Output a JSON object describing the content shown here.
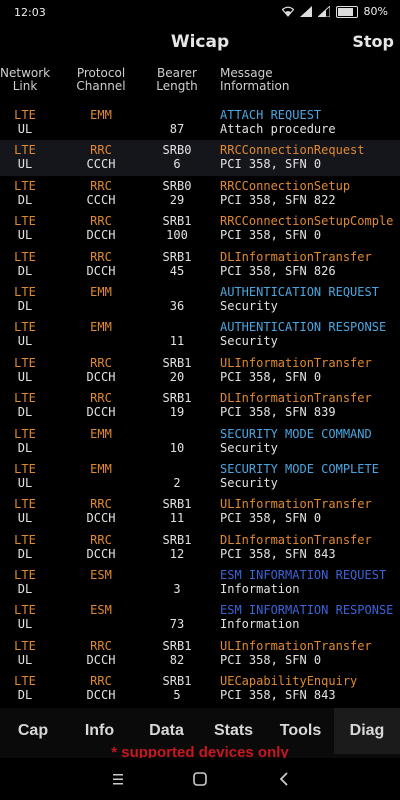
{
  "status_bar": {
    "time": "12:03",
    "battery": "80%",
    "icons": [
      "wifi-icon",
      "signal-icon",
      "signal-icon",
      "battery-icon"
    ]
  },
  "app": {
    "title": "Wicap",
    "stop_label": "Stop"
  },
  "columns": {
    "network": [
      "Network",
      "Link"
    ],
    "protocol": [
      "Protocol",
      "Channel"
    ],
    "bearer": [
      "Bearer",
      "Length"
    ],
    "message": [
      "Message",
      "Information"
    ]
  },
  "colors": {
    "orange": "#e0892f",
    "lightblue": "#4aa6e0",
    "blue": "#3a63d8",
    "notice_red": "#c8171f"
  },
  "rows": [
    {
      "net": "LTE",
      "link": "UL",
      "proto": "EMM",
      "chan": "",
      "bearer": "",
      "len": "87",
      "msg": "ATTACH REQUEST",
      "info": "Attach procedure",
      "color": "lightblue"
    },
    {
      "net": "LTE",
      "link": "UL",
      "proto": "RRC",
      "chan": "CCCH",
      "bearer": "SRB0",
      "len": "6",
      "msg": "RRCConnectionRequest",
      "info": "PCI 358, SFN 0",
      "color": "orange",
      "selected": true
    },
    {
      "net": "LTE",
      "link": "DL",
      "proto": "RRC",
      "chan": "CCCH",
      "bearer": "SRB0",
      "len": "29",
      "msg": "RRCConnectionSetup",
      "info": "PCI 358, SFN 822",
      "color": "orange"
    },
    {
      "net": "LTE",
      "link": "UL",
      "proto": "RRC",
      "chan": "DCCH",
      "bearer": "SRB1",
      "len": "100",
      "msg": "RRCConnectionSetupComple",
      "info": "PCI 358, SFN 0",
      "color": "orange"
    },
    {
      "net": "LTE",
      "link": "DL",
      "proto": "RRC",
      "chan": "DCCH",
      "bearer": "SRB1",
      "len": "45",
      "msg": "DLInformationTransfer",
      "info": "PCI 358, SFN 826",
      "color": "orange"
    },
    {
      "net": "LTE",
      "link": "DL",
      "proto": "EMM",
      "chan": "",
      "bearer": "",
      "len": "36",
      "msg": "AUTHENTICATION REQUEST",
      "info": "Security",
      "color": "lightblue"
    },
    {
      "net": "LTE",
      "link": "UL",
      "proto": "EMM",
      "chan": "",
      "bearer": "",
      "len": "11",
      "msg": "AUTHENTICATION RESPONSE",
      "info": "Security",
      "color": "lightblue"
    },
    {
      "net": "LTE",
      "link": "UL",
      "proto": "RRC",
      "chan": "DCCH",
      "bearer": "SRB1",
      "len": "20",
      "msg": "ULInformationTransfer",
      "info": "PCI 358, SFN 0",
      "color": "orange"
    },
    {
      "net": "LTE",
      "link": "DL",
      "proto": "RRC",
      "chan": "DCCH",
      "bearer": "SRB1",
      "len": "19",
      "msg": "DLInformationTransfer",
      "info": "PCI 358, SFN 839",
      "color": "orange"
    },
    {
      "net": "LTE",
      "link": "DL",
      "proto": "EMM",
      "chan": "",
      "bearer": "",
      "len": "10",
      "msg": "SECURITY MODE COMMAND",
      "info": "Security",
      "color": "lightblue"
    },
    {
      "net": "LTE",
      "link": "UL",
      "proto": "EMM",
      "chan": "",
      "bearer": "",
      "len": "2",
      "msg": "SECURITY MODE COMPLETE",
      "info": "Security",
      "color": "lightblue"
    },
    {
      "net": "LTE",
      "link": "UL",
      "proto": "RRC",
      "chan": "DCCH",
      "bearer": "SRB1",
      "len": "11",
      "msg": "ULInformationTransfer",
      "info": "PCI 358, SFN 0",
      "color": "orange"
    },
    {
      "net": "LTE",
      "link": "DL",
      "proto": "RRC",
      "chan": "DCCH",
      "bearer": "SRB1",
      "len": "12",
      "msg": "DLInformationTransfer",
      "info": "PCI 358, SFN 843",
      "color": "orange"
    },
    {
      "net": "LTE",
      "link": "DL",
      "proto": "ESM",
      "chan": "",
      "bearer": "",
      "len": "3",
      "msg": "ESM INFORMATION REQUEST",
      "info": "Information",
      "color": "blue"
    },
    {
      "net": "LTE",
      "link": "UL",
      "proto": "ESM",
      "chan": "",
      "bearer": "",
      "len": "73",
      "msg": "ESM INFORMATION RESPONSE",
      "info": "Information",
      "color": "blue"
    },
    {
      "net": "LTE",
      "link": "UL",
      "proto": "RRC",
      "chan": "DCCH",
      "bearer": "SRB1",
      "len": "82",
      "msg": "ULInformationTransfer",
      "info": "PCI 358, SFN 0",
      "color": "orange"
    },
    {
      "net": "LTE",
      "link": "DL",
      "proto": "RRC",
      "chan": "DCCH",
      "bearer": "SRB1",
      "len": "5",
      "msg": "UECapabilityEnquiry",
      "info": "PCI 358, SFN 843",
      "color": "orange"
    }
  ],
  "tabs": [
    {
      "label": "Cap"
    },
    {
      "label": "Info"
    },
    {
      "label": "Data"
    },
    {
      "label": "Stats"
    },
    {
      "label": "Tools"
    },
    {
      "label": "Diag",
      "active": true
    }
  ],
  "notice": "* supported devices only",
  "system_nav": [
    "menu-icon",
    "home-icon",
    "back-icon"
  ]
}
